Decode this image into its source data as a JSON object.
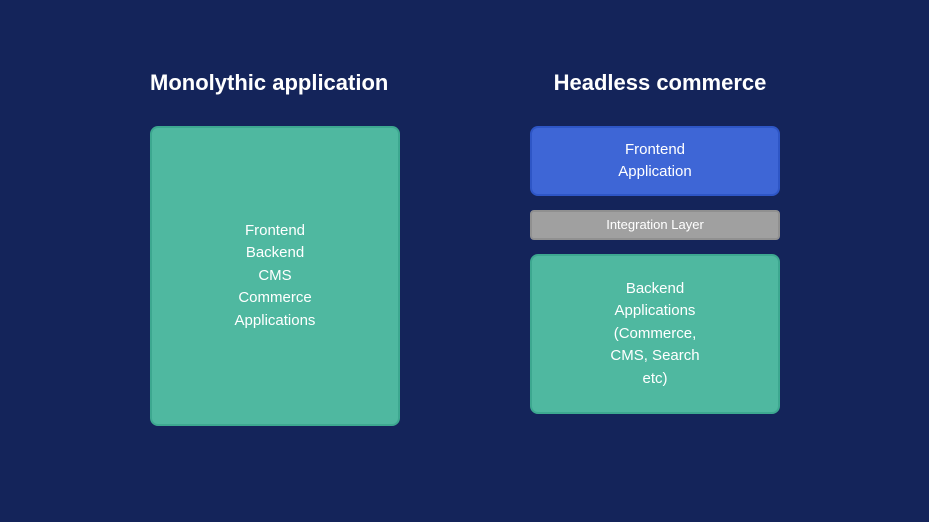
{
  "left": {
    "heading": "Monolythic application",
    "box": {
      "line1": "Frontend",
      "line2": "Backend",
      "line3": "CMS",
      "line4": "Commerce",
      "line5": "Applications"
    }
  },
  "right": {
    "heading": "Headless commerce",
    "frontend": {
      "line1": "Frontend",
      "line2": "Application"
    },
    "integration": "Integration Layer",
    "backend": {
      "line1": "Backend",
      "line2": "Applications",
      "line3": "(Commerce,",
      "line4": "CMS, Search",
      "line5": "etc)"
    }
  }
}
